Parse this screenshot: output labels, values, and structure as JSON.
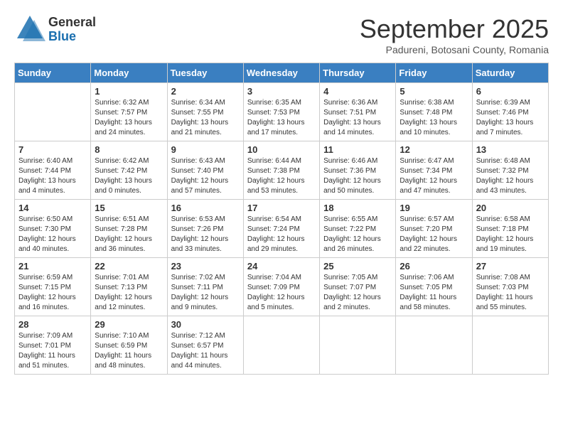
{
  "header": {
    "logo_general": "General",
    "logo_blue": "Blue",
    "title": "September 2025",
    "location": "Padureni, Botosani County, Romania"
  },
  "weekdays": [
    "Sunday",
    "Monday",
    "Tuesday",
    "Wednesday",
    "Thursday",
    "Friday",
    "Saturday"
  ],
  "weeks": [
    [
      {
        "day": "",
        "sunrise": "",
        "sunset": "",
        "daylight": ""
      },
      {
        "day": "1",
        "sunrise": "Sunrise: 6:32 AM",
        "sunset": "Sunset: 7:57 PM",
        "daylight": "Daylight: 13 hours and 24 minutes."
      },
      {
        "day": "2",
        "sunrise": "Sunrise: 6:34 AM",
        "sunset": "Sunset: 7:55 PM",
        "daylight": "Daylight: 13 hours and 21 minutes."
      },
      {
        "day": "3",
        "sunrise": "Sunrise: 6:35 AM",
        "sunset": "Sunset: 7:53 PM",
        "daylight": "Daylight: 13 hours and 17 minutes."
      },
      {
        "day": "4",
        "sunrise": "Sunrise: 6:36 AM",
        "sunset": "Sunset: 7:51 PM",
        "daylight": "Daylight: 13 hours and 14 minutes."
      },
      {
        "day": "5",
        "sunrise": "Sunrise: 6:38 AM",
        "sunset": "Sunset: 7:48 PM",
        "daylight": "Daylight: 13 hours and 10 minutes."
      },
      {
        "day": "6",
        "sunrise": "Sunrise: 6:39 AM",
        "sunset": "Sunset: 7:46 PM",
        "daylight": "Daylight: 13 hours and 7 minutes."
      }
    ],
    [
      {
        "day": "7",
        "sunrise": "Sunrise: 6:40 AM",
        "sunset": "Sunset: 7:44 PM",
        "daylight": "Daylight: 13 hours and 4 minutes."
      },
      {
        "day": "8",
        "sunrise": "Sunrise: 6:42 AM",
        "sunset": "Sunset: 7:42 PM",
        "daylight": "Daylight: 13 hours and 0 minutes."
      },
      {
        "day": "9",
        "sunrise": "Sunrise: 6:43 AM",
        "sunset": "Sunset: 7:40 PM",
        "daylight": "Daylight: 12 hours and 57 minutes."
      },
      {
        "day": "10",
        "sunrise": "Sunrise: 6:44 AM",
        "sunset": "Sunset: 7:38 PM",
        "daylight": "Daylight: 12 hours and 53 minutes."
      },
      {
        "day": "11",
        "sunrise": "Sunrise: 6:46 AM",
        "sunset": "Sunset: 7:36 PM",
        "daylight": "Daylight: 12 hours and 50 minutes."
      },
      {
        "day": "12",
        "sunrise": "Sunrise: 6:47 AM",
        "sunset": "Sunset: 7:34 PM",
        "daylight": "Daylight: 12 hours and 47 minutes."
      },
      {
        "day": "13",
        "sunrise": "Sunrise: 6:48 AM",
        "sunset": "Sunset: 7:32 PM",
        "daylight": "Daylight: 12 hours and 43 minutes."
      }
    ],
    [
      {
        "day": "14",
        "sunrise": "Sunrise: 6:50 AM",
        "sunset": "Sunset: 7:30 PM",
        "daylight": "Daylight: 12 hours and 40 minutes."
      },
      {
        "day": "15",
        "sunrise": "Sunrise: 6:51 AM",
        "sunset": "Sunset: 7:28 PM",
        "daylight": "Daylight: 12 hours and 36 minutes."
      },
      {
        "day": "16",
        "sunrise": "Sunrise: 6:53 AM",
        "sunset": "Sunset: 7:26 PM",
        "daylight": "Daylight: 12 hours and 33 minutes."
      },
      {
        "day": "17",
        "sunrise": "Sunrise: 6:54 AM",
        "sunset": "Sunset: 7:24 PM",
        "daylight": "Daylight: 12 hours and 29 minutes."
      },
      {
        "day": "18",
        "sunrise": "Sunrise: 6:55 AM",
        "sunset": "Sunset: 7:22 PM",
        "daylight": "Daylight: 12 hours and 26 minutes."
      },
      {
        "day": "19",
        "sunrise": "Sunrise: 6:57 AM",
        "sunset": "Sunset: 7:20 PM",
        "daylight": "Daylight: 12 hours and 22 minutes."
      },
      {
        "day": "20",
        "sunrise": "Sunrise: 6:58 AM",
        "sunset": "Sunset: 7:18 PM",
        "daylight": "Daylight: 12 hours and 19 minutes."
      }
    ],
    [
      {
        "day": "21",
        "sunrise": "Sunrise: 6:59 AM",
        "sunset": "Sunset: 7:15 PM",
        "daylight": "Daylight: 12 hours and 16 minutes."
      },
      {
        "day": "22",
        "sunrise": "Sunrise: 7:01 AM",
        "sunset": "Sunset: 7:13 PM",
        "daylight": "Daylight: 12 hours and 12 minutes."
      },
      {
        "day": "23",
        "sunrise": "Sunrise: 7:02 AM",
        "sunset": "Sunset: 7:11 PM",
        "daylight": "Daylight: 12 hours and 9 minutes."
      },
      {
        "day": "24",
        "sunrise": "Sunrise: 7:04 AM",
        "sunset": "Sunset: 7:09 PM",
        "daylight": "Daylight: 12 hours and 5 minutes."
      },
      {
        "day": "25",
        "sunrise": "Sunrise: 7:05 AM",
        "sunset": "Sunset: 7:07 PM",
        "daylight": "Daylight: 12 hours and 2 minutes."
      },
      {
        "day": "26",
        "sunrise": "Sunrise: 7:06 AM",
        "sunset": "Sunset: 7:05 PM",
        "daylight": "Daylight: 11 hours and 58 minutes."
      },
      {
        "day": "27",
        "sunrise": "Sunrise: 7:08 AM",
        "sunset": "Sunset: 7:03 PM",
        "daylight": "Daylight: 11 hours and 55 minutes."
      }
    ],
    [
      {
        "day": "28",
        "sunrise": "Sunrise: 7:09 AM",
        "sunset": "Sunset: 7:01 PM",
        "daylight": "Daylight: 11 hours and 51 minutes."
      },
      {
        "day": "29",
        "sunrise": "Sunrise: 7:10 AM",
        "sunset": "Sunset: 6:59 PM",
        "daylight": "Daylight: 11 hours and 48 minutes."
      },
      {
        "day": "30",
        "sunrise": "Sunrise: 7:12 AM",
        "sunset": "Sunset: 6:57 PM",
        "daylight": "Daylight: 11 hours and 44 minutes."
      },
      {
        "day": "",
        "sunrise": "",
        "sunset": "",
        "daylight": ""
      },
      {
        "day": "",
        "sunrise": "",
        "sunset": "",
        "daylight": ""
      },
      {
        "day": "",
        "sunrise": "",
        "sunset": "",
        "daylight": ""
      },
      {
        "day": "",
        "sunrise": "",
        "sunset": "",
        "daylight": ""
      }
    ]
  ]
}
